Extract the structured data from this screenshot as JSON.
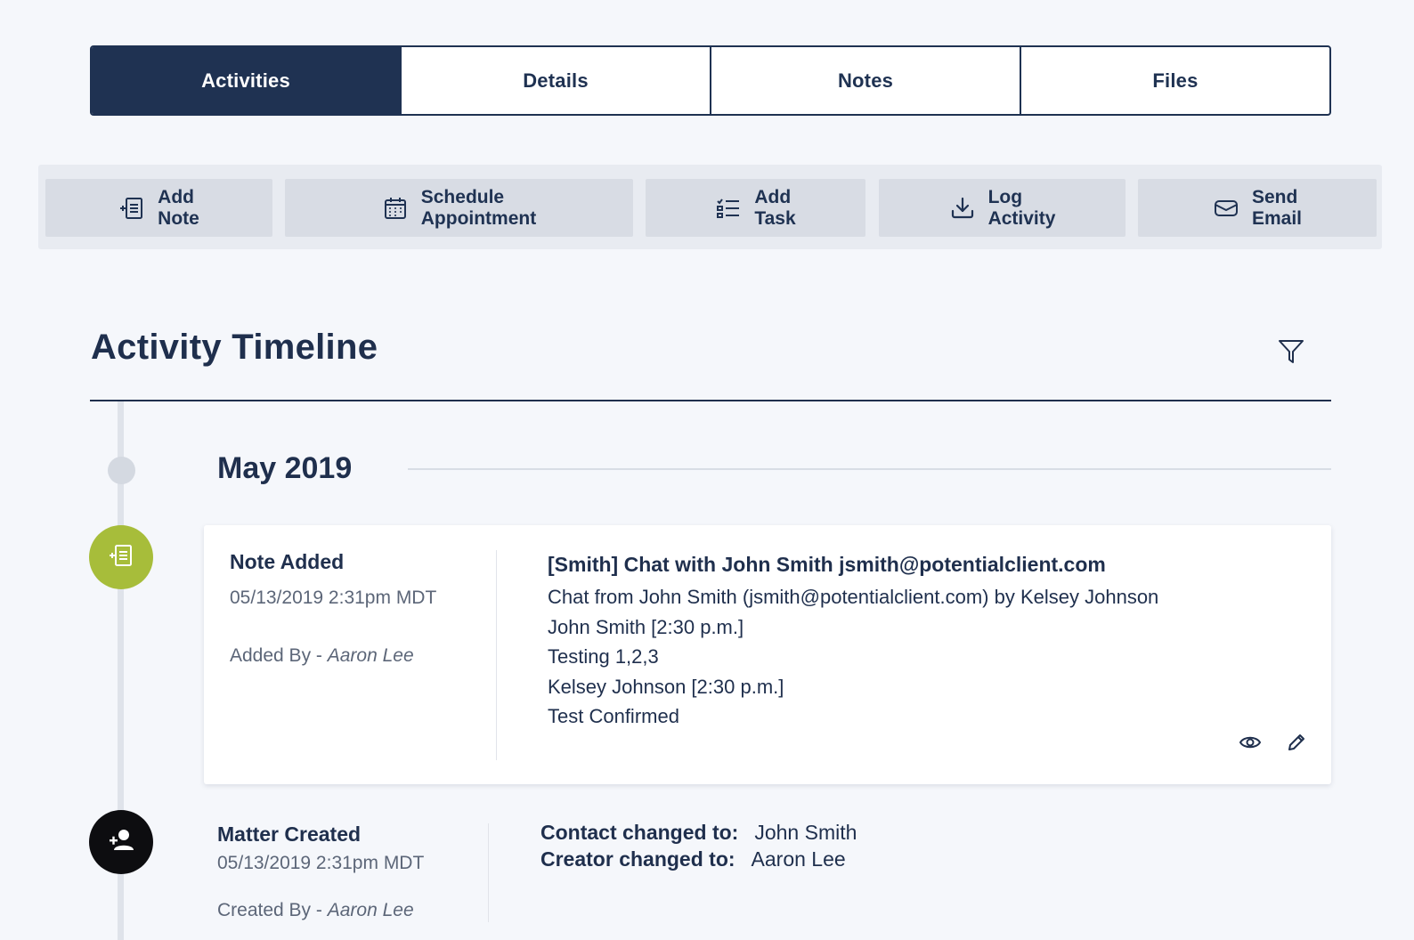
{
  "tabs": [
    {
      "label": "Activities",
      "active": true
    },
    {
      "label": "Details",
      "active": false
    },
    {
      "label": "Notes",
      "active": false
    },
    {
      "label": "Files",
      "active": false
    }
  ],
  "actions": [
    {
      "label": "Add Note",
      "icon": "add-note-icon"
    },
    {
      "label": "Schedule Appointment",
      "icon": "calendar-icon"
    },
    {
      "label": "Add Task",
      "icon": "checklist-icon"
    },
    {
      "label": "Log Activity",
      "icon": "download-icon"
    },
    {
      "label": "Send Email",
      "icon": "envelope-icon"
    }
  ],
  "timeline": {
    "title": "Activity Timeline",
    "filter_icon": "filter-icon",
    "month": "May 2019"
  },
  "note_event": {
    "title": "Note Added",
    "date": "05/13/2019 2:31pm MDT",
    "by_label": "Added By - ",
    "by_name": "Aaron Lee",
    "subject": "[Smith] Chat with John Smith jsmith@potentialclient.com",
    "lines": [
      "Chat from John Smith (jsmith@potentialclient.com) by Kelsey Johnson",
      "John Smith [2:30 p.m.]",
      "Testing 1,2,3",
      "Kelsey Johnson [2:30 p.m.]",
      "Test Confirmed"
    ],
    "accent": "#a7bd3a"
  },
  "matter_event": {
    "title": "Matter Created",
    "date": "05/13/2019 2:31pm MDT",
    "by_label": "Created By - ",
    "by_name": "Aaron Lee",
    "changes": [
      {
        "key": "Contact changed to:",
        "value": "John Smith"
      },
      {
        "key": "Creator changed to:",
        "value": "Aaron Lee"
      }
    ]
  },
  "colors": {
    "primary": "#1f3252",
    "background": "#f5f7fb"
  }
}
